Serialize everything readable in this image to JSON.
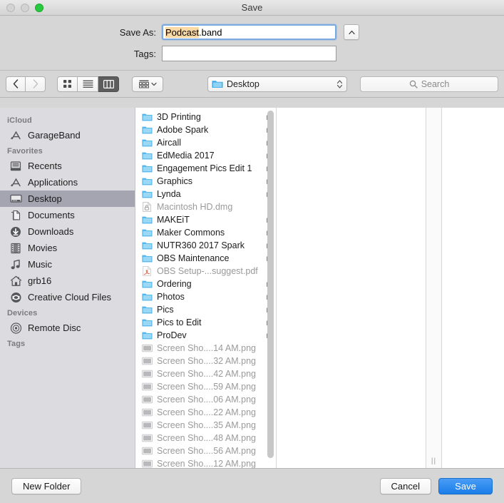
{
  "window": {
    "title": "Save",
    "traffic_lights": [
      {
        "name": "close",
        "state": "disabled",
        "color": "#d3d3d3"
      },
      {
        "name": "minimize",
        "state": "disabled",
        "color": "#d3d3d3"
      },
      {
        "name": "zoom",
        "state": "enabled",
        "color": "#28c940"
      }
    ]
  },
  "form": {
    "save_as_label": "Save As:",
    "save_as_value_selected": "Podcast",
    "save_as_value_rest": ".band",
    "save_as_full_value": "Podcast.band",
    "selection_highlight_color": "#fbd9a5",
    "expand_button_glyph": "⌃",
    "tags_label": "Tags:",
    "tags_value": "",
    "tags_placeholder": ""
  },
  "toolbar": {
    "back_glyph": "‹",
    "forward_glyph": "›",
    "view_modes": [
      {
        "name": "icon-view",
        "active": false
      },
      {
        "name": "list-view",
        "active": false
      },
      {
        "name": "column-view",
        "active": true
      }
    ],
    "group_by_label": "",
    "path_label": "Desktop",
    "search_placeholder": "Search"
  },
  "sidebar": {
    "sections": [
      {
        "header": "iCloud",
        "items": [
          {
            "label": "GarageBand",
            "icon": "app-store-icon",
            "selected": false
          }
        ]
      },
      {
        "header": "Favorites",
        "items": [
          {
            "label": "Recents",
            "icon": "recents-clock-icon",
            "selected": false
          },
          {
            "label": "Applications",
            "icon": "applications-icon",
            "selected": false
          },
          {
            "label": "Desktop",
            "icon": "desktop-icon",
            "selected": true
          },
          {
            "label": "Documents",
            "icon": "documents-icon",
            "selected": false
          },
          {
            "label": "Downloads",
            "icon": "downloads-icon",
            "selected": false
          },
          {
            "label": "Movies",
            "icon": "movies-film-icon",
            "selected": false
          },
          {
            "label": "Music",
            "icon": "music-note-icon",
            "selected": false
          },
          {
            "label": "grb16",
            "icon": "home-icon",
            "selected": false
          },
          {
            "label": "Creative Cloud Files",
            "icon": "creative-cloud-icon",
            "selected": false
          }
        ]
      },
      {
        "header": "Devices",
        "items": [
          {
            "label": "Remote Disc",
            "icon": "optical-disc-icon",
            "selected": false
          }
        ]
      },
      {
        "header": "Tags",
        "items": []
      }
    ]
  },
  "file_list": {
    "items": [
      {
        "name": "3D Printing",
        "type": "folder",
        "dim": false,
        "chevron": true
      },
      {
        "name": "Adobe Spark",
        "type": "folder",
        "dim": false,
        "chevron": true
      },
      {
        "name": "Aircall",
        "type": "folder",
        "dim": false,
        "chevron": true
      },
      {
        "name": "EdMedia 2017",
        "type": "folder",
        "dim": false,
        "chevron": true
      },
      {
        "name": "Engagement Pics Edit 1",
        "type": "folder",
        "dim": false,
        "chevron": true
      },
      {
        "name": "Graphics",
        "type": "folder",
        "dim": false,
        "chevron": true
      },
      {
        "name": "Lynda",
        "type": "folder",
        "dim": false,
        "chevron": true
      },
      {
        "name": "Macintosh HD.dmg",
        "type": "disk-image",
        "dim": true,
        "chevron": false
      },
      {
        "name": "MAKEiT",
        "type": "folder",
        "dim": false,
        "chevron": true
      },
      {
        "name": "Maker Commons",
        "type": "folder",
        "dim": false,
        "chevron": true
      },
      {
        "name": "NUTR360 2017 Spark",
        "type": "folder",
        "dim": false,
        "chevron": true
      },
      {
        "name": "OBS Maintenance",
        "type": "folder",
        "dim": false,
        "chevron": true
      },
      {
        "name": "OBS Setup-...suggest.pdf",
        "type": "pdf",
        "dim": true,
        "chevron": false
      },
      {
        "name": "Ordering",
        "type": "folder",
        "dim": false,
        "chevron": true
      },
      {
        "name": "Photos",
        "type": "folder",
        "dim": false,
        "chevron": true
      },
      {
        "name": "Pics",
        "type": "folder",
        "dim": false,
        "chevron": true
      },
      {
        "name": "Pics to Edit",
        "type": "folder",
        "dim": false,
        "chevron": true
      },
      {
        "name": "ProDev",
        "type": "folder",
        "dim": false,
        "chevron": true
      },
      {
        "name": "Screen Sho....14 AM.png",
        "type": "image",
        "dim": true,
        "chevron": false
      },
      {
        "name": "Screen Sho....32 AM.png",
        "type": "image",
        "dim": true,
        "chevron": false
      },
      {
        "name": "Screen Sho....42 AM.png",
        "type": "image",
        "dim": true,
        "chevron": false
      },
      {
        "name": "Screen Sho....59 AM.png",
        "type": "image",
        "dim": true,
        "chevron": false
      },
      {
        "name": "Screen Sho....06 AM.png",
        "type": "image",
        "dim": true,
        "chevron": false
      },
      {
        "name": "Screen Sho....22 AM.png",
        "type": "image",
        "dim": true,
        "chevron": false
      },
      {
        "name": "Screen Sho....35 AM.png",
        "type": "image",
        "dim": true,
        "chevron": false
      },
      {
        "name": "Screen Sho....48 AM.png",
        "type": "image",
        "dim": true,
        "chevron": false
      },
      {
        "name": "Screen Sho....56 AM.png",
        "type": "image",
        "dim": true,
        "chevron": false
      },
      {
        "name": "Screen Sho....12 AM.png",
        "type": "image",
        "dim": true,
        "chevron": false
      }
    ]
  },
  "footer": {
    "new_folder_label": "New Folder",
    "cancel_label": "Cancel",
    "save_label": "Save",
    "save_button_color": "#1a7ee8"
  }
}
